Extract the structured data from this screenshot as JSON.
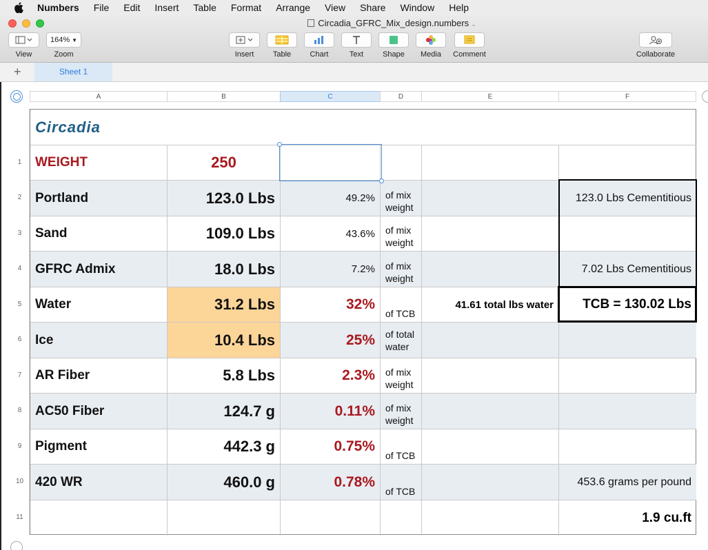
{
  "menubar": {
    "app_name": "Numbers",
    "items": [
      "File",
      "Edit",
      "Insert",
      "Table",
      "Format",
      "Arrange",
      "View",
      "Share",
      "Window",
      "Help"
    ]
  },
  "window": {
    "title": "Circadia_GFRC_Mix_design.numbers",
    "colors": {
      "close": "#fc605b",
      "minimize": "#fdbc40",
      "zoom": "#34c84a"
    }
  },
  "toolbar": {
    "view_label": "View",
    "zoom_value": "164%",
    "zoom_label": "Zoom",
    "insert_label": "Insert",
    "table_label": "Table",
    "chart_label": "Chart",
    "text_label": "Text",
    "shape_label": "Shape",
    "media_label": "Media",
    "comment_label": "Comment",
    "collaborate_label": "Collaborate"
  },
  "tabs": {
    "add_symbol": "+",
    "sheet_name": "Sheet 1"
  },
  "columns": [
    "A",
    "B",
    "C",
    "D",
    "E",
    "F"
  ],
  "selected_column": "C",
  "table": {
    "title": "Circadia",
    "weight_label": "WEIGHT",
    "weight_value": "250",
    "rows": [
      {
        "num": "1"
      },
      {
        "num": "2",
        "label": "Portland",
        "amount": "123.0 Lbs",
        "pct": "49.2%",
        "unit": "of mix weight",
        "e": "",
        "f": "123.0 Lbs Cementitious"
      },
      {
        "num": "3",
        "label": "Sand",
        "amount": "109.0 Lbs",
        "pct": "43.6%",
        "unit": "of mix weight",
        "e": "",
        "f": ""
      },
      {
        "num": "4",
        "label": "GFRC Admix",
        "amount": "18.0 Lbs",
        "pct": "7.2%",
        "unit": "of mix weight",
        "e": "",
        "f": "7.02 Lbs Cementitious"
      },
      {
        "num": "5",
        "label": "Water",
        "amount": "31.2 Lbs",
        "pct": "32%",
        "unit": "of TCB",
        "e": "41.61 total lbs water",
        "f": "TCB = 130.02 Lbs"
      },
      {
        "num": "6",
        "label": "Ice",
        "amount": "10.4 Lbs",
        "pct": "25%",
        "unit": "of total water",
        "e": "",
        "f": ""
      },
      {
        "num": "7",
        "label": "AR Fiber",
        "amount": "5.8 Lbs",
        "pct": "2.3%",
        "unit": "of mix weight",
        "e": "",
        "f": ""
      },
      {
        "num": "8",
        "label": "AC50 Fiber",
        "amount": "124.7 g",
        "pct": "0.11%",
        "unit": "of mix weight",
        "e": "",
        "f": ""
      },
      {
        "num": "9",
        "label": "Pigment",
        "amount": "442.3 g",
        "pct": "0.75%",
        "unit": "of TCB",
        "e": "",
        "f": ""
      },
      {
        "num": "10",
        "label": "420 WR",
        "amount": "460.0 g",
        "pct": "0.78%",
        "unit": "of TCB",
        "e": "",
        "f": "453.6 grams per pound"
      },
      {
        "num": "11",
        "label": "",
        "amount": "",
        "pct": "",
        "unit": "",
        "e": "",
        "f": "1.9 cu.ft"
      }
    ]
  },
  "colors": {
    "accent_red": "#a8191f",
    "title_blue": "#1f5f86",
    "highlight_orange": "#fcd598",
    "row_stripe": "#e8edf2",
    "selection_blue": "#4a90d9"
  }
}
